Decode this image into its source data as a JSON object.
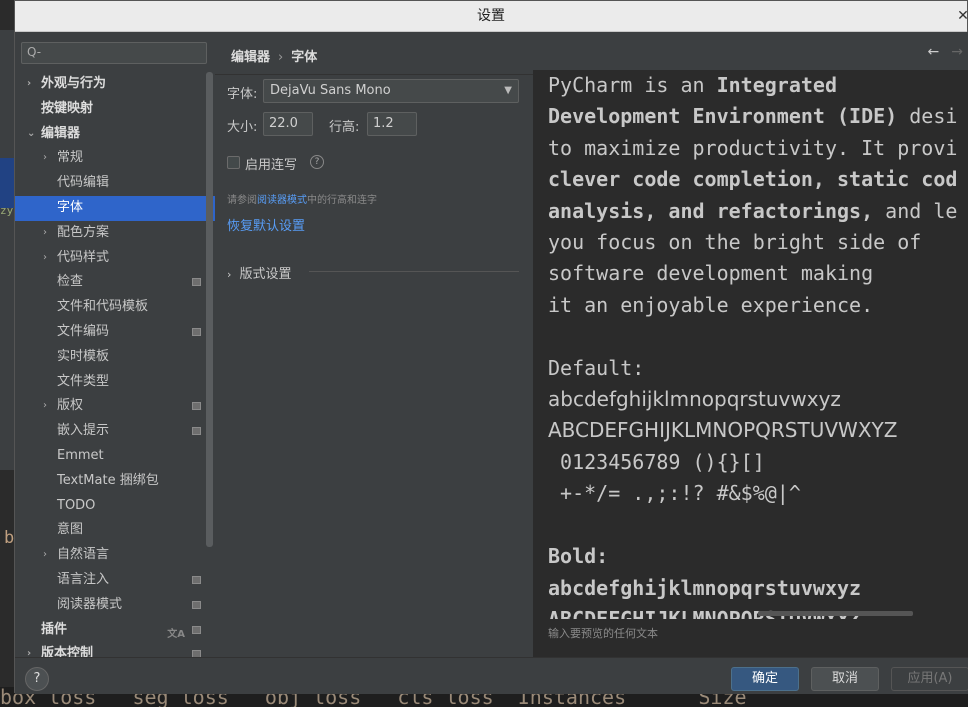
{
  "dialog": {
    "title": "设置"
  },
  "background": {
    "terminal_line": "box_loss   seg_loss   obj_loss   cls_loss  Instances      Size",
    "frag_b": "b",
    "frag_zy": "zy"
  },
  "sidebar": {
    "search_placeholder": "Q-",
    "items": [
      {
        "label": "外观与行为",
        "indent": 0,
        "arrow": "›",
        "bold": true
      },
      {
        "label": "按键映射",
        "indent": 0,
        "arrow": "",
        "bold": true
      },
      {
        "label": "编辑器",
        "indent": 0,
        "arrow": "⌄",
        "bold": true
      },
      {
        "label": "常规",
        "indent": 1,
        "arrow": "›"
      },
      {
        "label": "代码编辑",
        "indent": 1,
        "arrow": ""
      },
      {
        "label": "字体",
        "indent": 1,
        "arrow": "",
        "selected": true
      },
      {
        "label": "配色方案",
        "indent": 1,
        "arrow": "›"
      },
      {
        "label": "代码样式",
        "indent": 1,
        "arrow": "›"
      },
      {
        "label": "检查",
        "indent": 1,
        "arrow": "",
        "mark": true
      },
      {
        "label": "文件和代码模板",
        "indent": 1,
        "arrow": ""
      },
      {
        "label": "文件编码",
        "indent": 1,
        "arrow": "",
        "mark": true
      },
      {
        "label": "实时模板",
        "indent": 1,
        "arrow": ""
      },
      {
        "label": "文件类型",
        "indent": 1,
        "arrow": ""
      },
      {
        "label": "版权",
        "indent": 1,
        "arrow": "›",
        "mark": true
      },
      {
        "label": "嵌入提示",
        "indent": 1,
        "arrow": "",
        "mark": true
      },
      {
        "label": "Emmet",
        "indent": 1,
        "arrow": ""
      },
      {
        "label": "TextMate 捆绑包",
        "indent": 1,
        "arrow": ""
      },
      {
        "label": "TODO",
        "indent": 1,
        "arrow": ""
      },
      {
        "label": "意图",
        "indent": 1,
        "arrow": ""
      },
      {
        "label": "自然语言",
        "indent": 1,
        "arrow": "›"
      },
      {
        "label": "语言注入",
        "indent": 1,
        "arrow": "",
        "mark": true
      },
      {
        "label": "阅读器模式",
        "indent": 1,
        "arrow": "",
        "mark": true
      },
      {
        "label": "插件",
        "indent": 0,
        "arrow": "",
        "bold": true,
        "mark": true,
        "mark2": "文A"
      },
      {
        "label": "版本控制",
        "indent": 0,
        "arrow": "›",
        "bold": true,
        "mark": true
      }
    ]
  },
  "main": {
    "breadcrumb": [
      "编辑器",
      "字体"
    ],
    "nav_back": "←",
    "nav_forward": "→",
    "font_label": "字体:",
    "font_value": "DejaVu Sans Mono",
    "size_label": "大小:",
    "size_value": "22.0",
    "line_height_label": "行高:",
    "line_height_value": "1.2",
    "ligatures_label": "启用连写",
    "help_icon": "?",
    "hint_prefix": "请参阅",
    "hint_link": "阅读器模式",
    "hint_suffix": "中的行高和连字",
    "restore_link": "恢复默认设置",
    "typography_section": "版式设置"
  },
  "preview": {
    "line1a": "PyCharm is an ",
    "line1b": "Integrated",
    "line2a": "Development Environment (IDE)",
    "line2b": " desi",
    "line3": "to maximize productivity. It provi",
    "line4": "clever code completion, static cod",
    "line5a": "analysis, and refactorings,",
    "line5b": " and le",
    "line6": "you focus on the bright side of",
    "line7": "software development making",
    "line8": "it an enjoyable experience.",
    "default_label": "Default:",
    "lower": "abcdefghijklmnopqrstuvwxyz",
    "upper": "ABCDEFGHIJKLMNOPQRSTUVWXYZ",
    "digits": " 0123456789 (){}[]",
    "symbols": " +-*/= .,;:!? #&$%@|^",
    "bold_label": "Bold:",
    "bold_lower": "abcdefghijklmnopqrstuvwxyz",
    "bold_upper": "ABCDEFGHIJKLMNOPQRSTUVWXYZ",
    "placeholder": "输入要预览的任何文本"
  },
  "footer": {
    "help": "?",
    "ok": "确定",
    "cancel": "取消",
    "apply": "应用(A)"
  }
}
